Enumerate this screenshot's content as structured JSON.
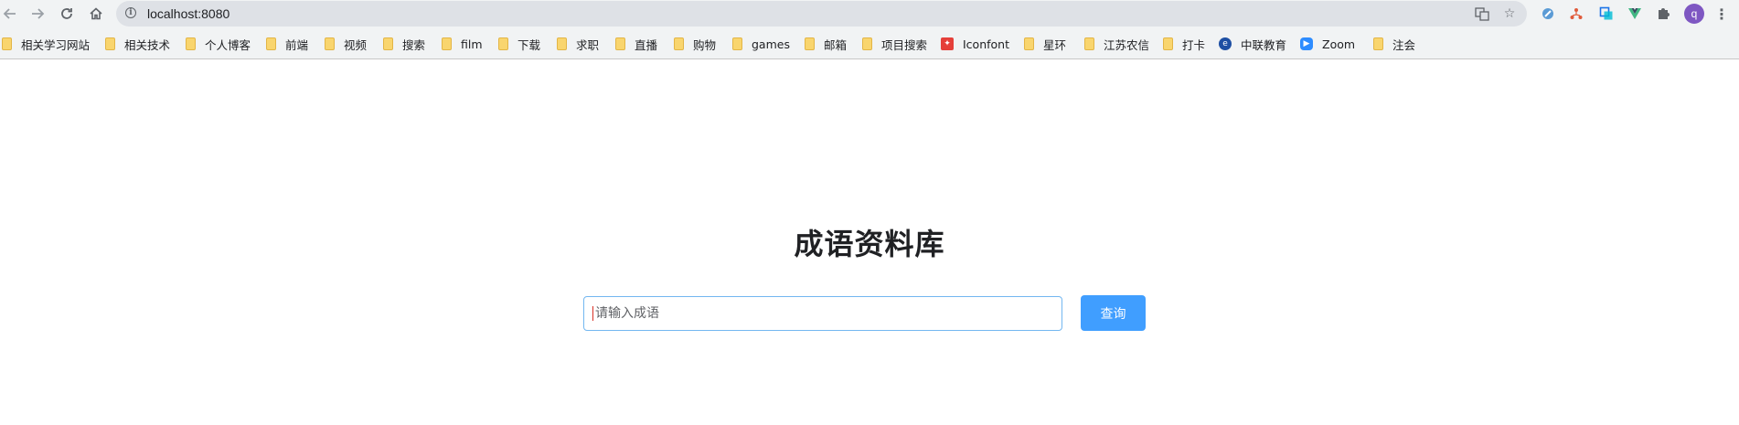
{
  "browser": {
    "url": "localhost:8080",
    "avatar_letter": "q",
    "bookmarks": [
      {
        "label": "相关学习网站",
        "icon": "folder-icon"
      },
      {
        "label": "相关技术",
        "icon": "folder-icon"
      },
      {
        "label": "个人博客",
        "icon": "folder-icon"
      },
      {
        "label": "前端",
        "icon": "folder-icon"
      },
      {
        "label": "视频",
        "icon": "folder-icon"
      },
      {
        "label": "搜索",
        "icon": "folder-icon"
      },
      {
        "label": "film",
        "icon": "folder-icon"
      },
      {
        "label": "下载",
        "icon": "folder-icon"
      },
      {
        "label": "求职",
        "icon": "folder-icon"
      },
      {
        "label": "直播",
        "icon": "folder-icon"
      },
      {
        "label": "购物",
        "icon": "folder-icon"
      },
      {
        "label": "games",
        "icon": "folder-icon"
      },
      {
        "label": "邮箱",
        "icon": "folder-icon"
      },
      {
        "label": "项目搜索",
        "icon": "folder-icon"
      },
      {
        "label": "Iconfont",
        "icon": "iconfont-favicon-icon"
      },
      {
        "label": "星环",
        "icon": "folder-icon"
      },
      {
        "label": "江苏农信",
        "icon": "folder-icon"
      },
      {
        "label": "打卡",
        "icon": "folder-icon"
      },
      {
        "label": "中联教育",
        "icon": "zhonglian-favicon-icon"
      },
      {
        "label": "Zoom",
        "icon": "zoom-favicon-icon"
      },
      {
        "label": "注会",
        "icon": "folder-icon"
      }
    ]
  },
  "page": {
    "title": "成语资料库",
    "search": {
      "placeholder": "请输入成语",
      "value": "",
      "button_label": "查询"
    }
  },
  "colors": {
    "accent": "#409eff",
    "input_border": "#73b7f0",
    "folder": "#f9d56e"
  }
}
